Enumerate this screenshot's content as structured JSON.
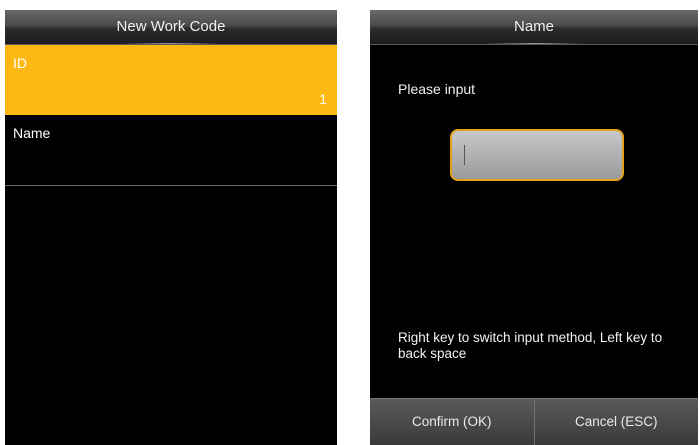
{
  "left_screen": {
    "title": "New Work Code",
    "fields": [
      {
        "label": "ID",
        "value": "1"
      },
      {
        "label": "Name",
        "value": ""
      }
    ]
  },
  "right_screen": {
    "title": "Name",
    "prompt": "Please input",
    "input_value": "",
    "hint": "Right key to switch input method, Left key to back space",
    "buttons": {
      "confirm": "Confirm (OK)",
      "cancel": "Cancel (ESC)"
    }
  },
  "colors": {
    "selection": "#fdb813",
    "input_border": "#e0a21a",
    "background": "#000000"
  }
}
